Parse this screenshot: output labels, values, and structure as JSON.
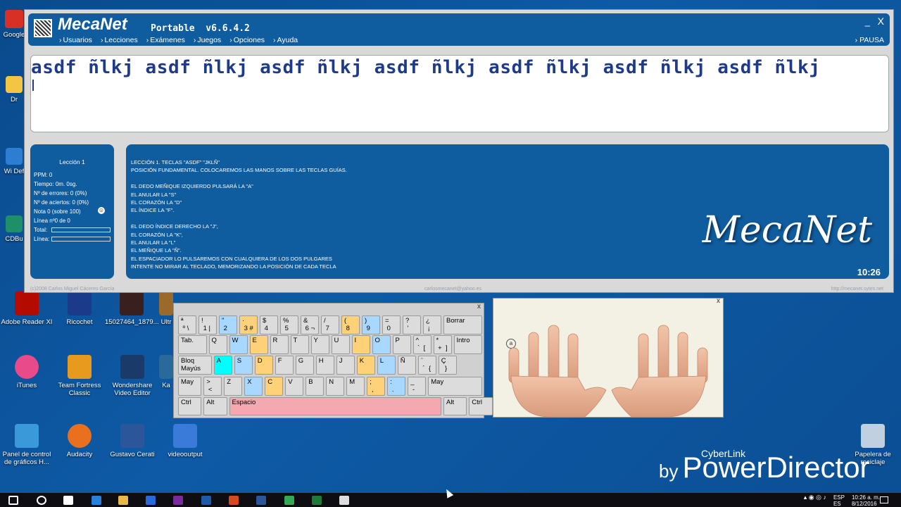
{
  "desktop": {
    "icons": [
      {
        "label": "Google",
        "color": "#d93025"
      },
      {
        "label": "Dr",
        "color": "#f4c542"
      },
      {
        "label": "Wi Def",
        "color": "#2d7dd2"
      },
      {
        "label": "CDBu",
        "color": "#1f8f6a"
      },
      {
        "label": "Adobe Reader XI",
        "color": "#b30b00"
      },
      {
        "label": "Ricochet",
        "color": "#1b3a8a"
      },
      {
        "label": "15027464_1879...",
        "color": "#3a1f1f"
      },
      {
        "label": "Ultr",
        "color": "#9a6a2a"
      },
      {
        "label": "iTunes",
        "color": "#e84a8a"
      },
      {
        "label": "Team Fortress Classic",
        "color": "#e89a1f"
      },
      {
        "label": "Wondershare Video Editor",
        "color": "#1a3a6a"
      },
      {
        "label": "Ka",
        "color": "#2a6a9a"
      },
      {
        "label": "Panel de control de gráficos H...",
        "color": "#3a9ad9"
      },
      {
        "label": "Audacity",
        "color": "#e8701f"
      },
      {
        "label": "Gustavo Cerati",
        "color": "#2b579a"
      },
      {
        "label": "videooutput",
        "color": "#3a7ad9"
      },
      {
        "label": "Papelera de reciclaje",
        "color": "#c0d0e0"
      }
    ]
  },
  "app": {
    "name": "MecaNet",
    "subtitle": "Portable  v6.6.4.2",
    "menu": [
      "Usuarios",
      "Lecciones",
      "Exámenes",
      "Juegos",
      "Opciones",
      "Ayuda"
    ],
    "pause_label": "PAUSA",
    "minimize_label": "_",
    "close_label": "X",
    "practice_text": "asdf ñlkj asdf ñlkj asdf ñlkj asdf ñlkj asdf ñlkj asdf ñlkj asdf ñlkj",
    "stats": {
      "title": "Lección 1",
      "ppm": "PPM: 0",
      "tiempo": "Tiempo: 0m. 0sg.",
      "errores": "Nº de errores: 0 (0%)",
      "aciertos": "Nº de aciertos: 0 (0%)",
      "nota": "Nota 0 (sobre 100)",
      "linea": "Línea nº0 de 0",
      "total_label": "Total:",
      "linea_label": "Línea:",
      "total_progress": 0,
      "linea_progress": 0
    },
    "lesson_text": "LECCIÓN 1. TECLAS \"ASDF\" \"JKLÑ\"\nPOSICIÓN FUNDAMENTAL. COLOCAREMOS LAS MANOS SOBRE LAS TECLAS GUÍAS.\n\nEL DEDO MEÑIQUE IZQUIERDO PULSARÁ LA \"A\"\nEL ANULAR LA \"S\"\nEL CORAZÓN LA \"D\"\nEL ÍNDICE LA \"F\".\n\nEL DEDO ÍNDICE DERECHO LA \"J\",\nEL CORAZÓN LA \"K\",\nEL ANULAR LA \"L\"\nEL MEÑIQUE LA \"Ñ\".\nEL ESPACIADOR LO PULSAREMOS CON CUALQUIERA DE LOS DOS PULGARES\nINTENTE NO MIRAR AL TECLADO, MEMORIZANDO LA POSICIÓN DE CADA TECLA",
    "brand_mark": "MecaNet",
    "clock": "10:26",
    "copyright": "(c)2008 Carlos Miguel Cáceres García",
    "email": "carlosmecanet@yahoo.es",
    "website": "http://mecanet.sytes.net"
  },
  "keyboard": {
    "close_label": "x",
    "rows": [
      [
        {
          "t": "ª\n º \\",
          "c": "g"
        },
        {
          "t": "!\n 1 |",
          "c": "g"
        },
        {
          "t": "\"\n 2",
          "c": "b"
        },
        {
          "t": "·\n 3 #",
          "c": "y"
        },
        {
          "t": "$\n 4",
          "c": "g"
        },
        {
          "t": "%\n 5",
          "c": "g"
        },
        {
          "t": "&\n 6 ¬",
          "c": "g"
        },
        {
          "t": "/\n 7",
          "c": "g"
        },
        {
          "t": "(\n 8",
          "c": "y"
        },
        {
          "t": ")\n 9",
          "c": "b"
        },
        {
          "t": "=\n 0",
          "c": "g"
        },
        {
          "t": "?\n '",
          "c": "g"
        },
        {
          "t": "¿\n ¡",
          "c": "g"
        },
        {
          "t": "Borrar",
          "c": "g",
          "w": 2
        }
      ],
      [
        {
          "t": "Tab.",
          "c": "g",
          "w": 1.5
        },
        {
          "t": "Q",
          "c": "g"
        },
        {
          "t": "W",
          "c": "b"
        },
        {
          "t": "E",
          "c": "y"
        },
        {
          "t": "R",
          "c": "g"
        },
        {
          "t": "T",
          "c": "g"
        },
        {
          "t": "Y",
          "c": "g"
        },
        {
          "t": "U",
          "c": "g"
        },
        {
          "t": "I",
          "c": "y"
        },
        {
          "t": "O",
          "c": "b"
        },
        {
          "t": "P",
          "c": "g"
        },
        {
          "t": "^\n `  [",
          "c": "g"
        },
        {
          "t": "*\n +  ]",
          "c": "g"
        },
        {
          "t": "Intro",
          "c": "g",
          "w": 1.5
        }
      ],
      [
        {
          "t": "Bloq\nMayús",
          "c": "g",
          "w": 1.75
        },
        {
          "t": "A",
          "c": "c"
        },
        {
          "t": "S",
          "c": "b"
        },
        {
          "t": "D",
          "c": "y"
        },
        {
          "t": "F",
          "c": "g"
        },
        {
          "t": "G",
          "c": "g"
        },
        {
          "t": "H",
          "c": "g"
        },
        {
          "t": "J",
          "c": "g"
        },
        {
          "t": "K",
          "c": "y"
        },
        {
          "t": "L",
          "c": "b"
        },
        {
          "t": "Ñ",
          "c": "g"
        },
        {
          "t": "¨\n ´  {",
          "c": "g"
        },
        {
          "t": "Ç\n  }",
          "c": "g"
        }
      ],
      [
        {
          "t": "May",
          "c": "g",
          "w": 1.25
        },
        {
          "t": ">\n <",
          "c": "g"
        },
        {
          "t": "Z",
          "c": "g"
        },
        {
          "t": "X",
          "c": "b"
        },
        {
          "t": "C",
          "c": "y"
        },
        {
          "t": "V",
          "c": "g"
        },
        {
          "t": "B",
          "c": "g"
        },
        {
          "t": "N",
          "c": "g"
        },
        {
          "t": "M",
          "c": "g"
        },
        {
          "t": ";\n ,",
          "c": "y"
        },
        {
          "t": ":\n .",
          "c": "b"
        },
        {
          "t": "_\n -",
          "c": "g"
        },
        {
          "t": "May",
          "c": "g",
          "w": 2.75
        }
      ],
      [
        {
          "t": "Ctrl",
          "c": "g",
          "w": 1.25
        },
        {
          "t": "Alt",
          "c": "g",
          "w": 1.25
        },
        {
          "t": "Espacio",
          "c": "p",
          "w": 10.5
        },
        {
          "t": "Alt",
          "c": "g",
          "w": 1.25
        },
        {
          "t": "Ctrl",
          "c": "g",
          "w": 1.25
        }
      ]
    ]
  },
  "hands": {
    "close_label": "x",
    "hint_key": "a"
  },
  "watermark": {
    "small": "CyberLink",
    "by": "by",
    "big": "PowerDirector"
  },
  "taskbar": {
    "apps": [
      "#1f6fd1",
      "#ffffff",
      "#2a7fd6",
      "#e8b84a",
      "#2a6ad6",
      "#7a2a9a",
      "#1f5aa8",
      "#d24a1f",
      "#2b579a",
      "#34a853",
      "#1f7a3a",
      "#dddddd"
    ],
    "lang": "ESP",
    "lang_sub": "ES",
    "time": "10:26 a. m.",
    "date": "8/12/2016"
  }
}
